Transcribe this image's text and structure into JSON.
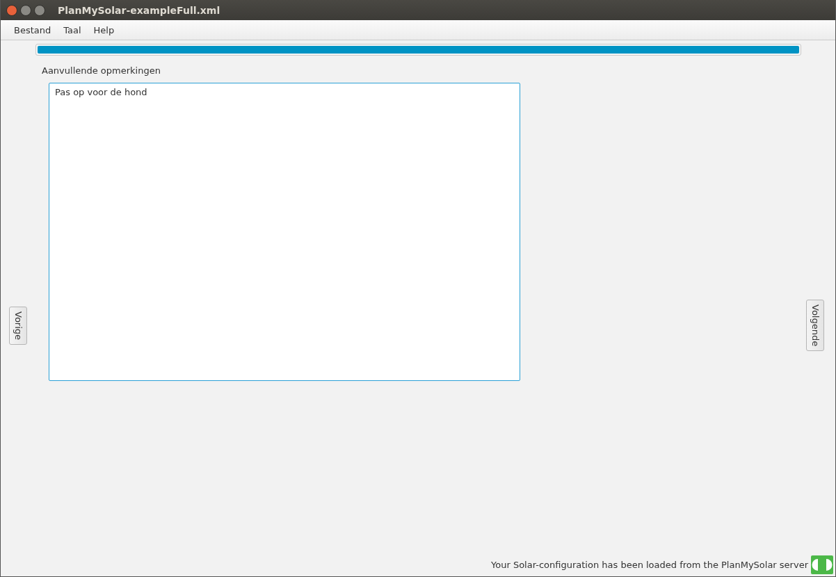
{
  "window": {
    "title": "PlanMySolar-exampleFull.xml"
  },
  "menu": [
    "Bestand",
    "Taal",
    "Help"
  ],
  "progress": {
    "level": 1.0
  },
  "remarks": {
    "label": "Aanvullende opmerkingen",
    "value": "Pas op voor de hond"
  },
  "nav": {
    "previous": "Vorige",
    "next": "Volgende"
  },
  "status_bar": {
    "text": "Your Solar-configuration has been loaded from the PlanMySolar server",
    "connected": true
  }
}
